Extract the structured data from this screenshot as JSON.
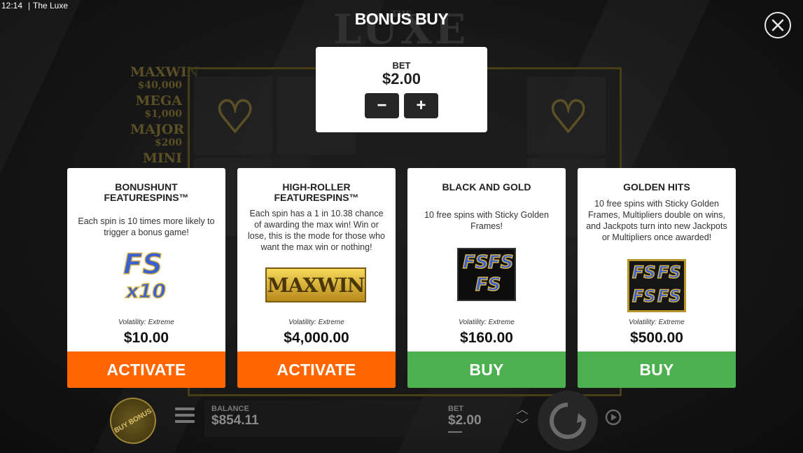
{
  "status_bar": {
    "time": "12:14",
    "separator": "|",
    "app_name": "The Luxe"
  },
  "game": {
    "logo_small": "THE",
    "logo_text": "LUXE",
    "jackpots": [
      {
        "name": "MAXWIN",
        "amount": "$40,000"
      },
      {
        "name": "MEGA",
        "amount": "$1,000"
      },
      {
        "name": "MAJOR",
        "amount": "$200"
      },
      {
        "name": "MINI",
        "amount": ""
      }
    ]
  },
  "modal": {
    "title": "BONUS BUY",
    "close_icon": "close-icon",
    "bet": {
      "label": "BET",
      "value": "$2.00",
      "minus": "−",
      "plus": "+"
    },
    "cards": [
      {
        "title": "BONUSHUNT FEATURESPINS™",
        "description": "Each spin is 10 times more likely to trigger a bonus game!",
        "image_icon": "fs-x10-icon",
        "image_text_main": "FS",
        "image_text_sub": "x10",
        "volatility": "Volatility: Extreme",
        "price": "$10.00",
        "button_label": "ACTIVATE",
        "button_color": "#ff6600"
      },
      {
        "title": "HIGH-ROLLER FEATURESPINS™",
        "description": "Each spin has a 1 in 10.38 chance of awarding the max win! Win or lose, this is the mode for those who want the max win or nothing!",
        "image_icon": "maxwin-icon",
        "image_text_main": "MAXWIN",
        "volatility": "Volatility: Extreme",
        "price": "$4,000.00",
        "button_label": "ACTIVATE",
        "button_color": "#ff6600"
      },
      {
        "title": "BLACK AND GOLD",
        "description": "10 free spins with Sticky Golden Frames!",
        "image_icon": "fs-triple-icon",
        "image_text_main": "FS",
        "volatility": "Volatility: Extreme",
        "price": "$160.00",
        "button_label": "BUY",
        "button_color": "#4caf50"
      },
      {
        "title": "GOLDEN HITS",
        "description": "10 free spins with Sticky Golden Frames, Multipliers double on wins, and Jackpots turn into new Jackpots or Multipliers once awarded!",
        "image_icon": "fs-quad-icon",
        "image_text_main": "FS",
        "volatility": "Volatility: Extreme",
        "price": "$500.00",
        "button_label": "BUY",
        "button_color": "#4caf50"
      }
    ]
  },
  "bottom_bar": {
    "buy_bonus_label": "BUY BONUS",
    "balance_label": "BALANCE",
    "balance_value": "$854.11",
    "bet_label": "BET",
    "bet_value": "$2.00"
  },
  "colors": {
    "activate": "#ff6600",
    "buy": "#4caf50",
    "gold": "#d4b24a"
  }
}
